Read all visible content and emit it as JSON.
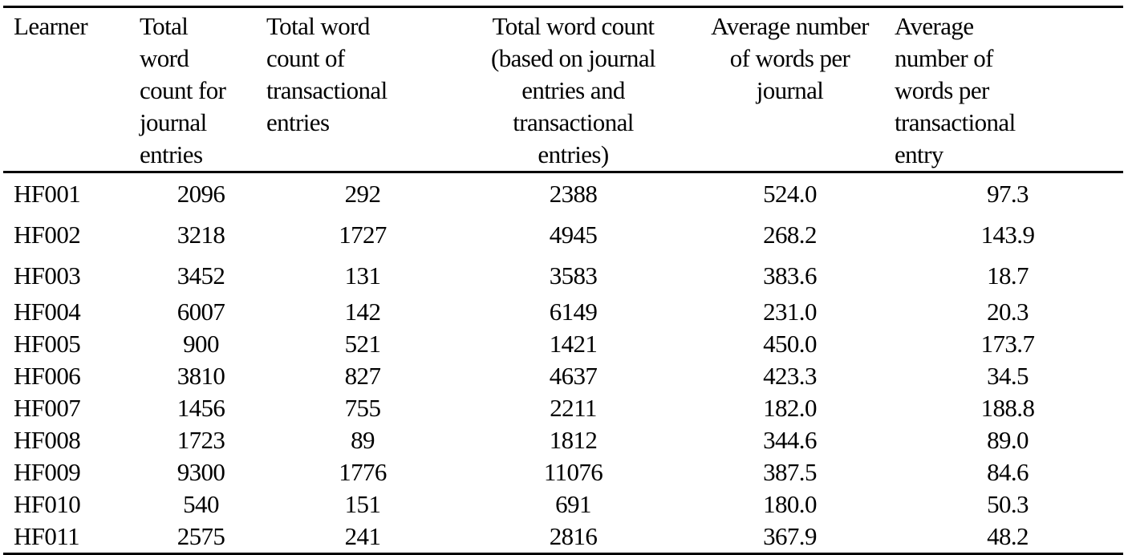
{
  "table": {
    "headers": [
      {
        "lines": [
          "Learner"
        ]
      },
      {
        "lines": [
          "Total",
          "word",
          "count for",
          "journal",
          "entries"
        ]
      },
      {
        "lines": [
          "Total word",
          "count of",
          "transactional",
          "entries"
        ]
      },
      {
        "lines": [
          "Total word count",
          "(based on journal",
          "entries and",
          "transactional",
          "entries)"
        ]
      },
      {
        "lines": [
          "Average number",
          "of words per",
          "journal"
        ]
      },
      {
        "lines": [
          "Average",
          "number of",
          "words per",
          "transactional",
          "entry"
        ]
      }
    ],
    "rows": [
      {
        "learner": "HF001",
        "journal_words": "2096",
        "transactional_words": "292",
        "total_words": "2388",
        "avg_per_journal": "524.0",
        "avg_per_transactional": "97.3"
      },
      {
        "learner": "HF002",
        "journal_words": "3218",
        "transactional_words": "1727",
        "total_words": "4945",
        "avg_per_journal": "268.2",
        "avg_per_transactional": "143.9"
      },
      {
        "learner": "HF003",
        "journal_words": "3452",
        "transactional_words": "131",
        "total_words": "3583",
        "avg_per_journal": "383.6",
        "avg_per_transactional": "18.7"
      },
      {
        "learner": "HF004",
        "journal_words": "6007",
        "transactional_words": "142",
        "total_words": "6149",
        "avg_per_journal": "231.0",
        "avg_per_transactional": "20.3"
      },
      {
        "learner": "HF005",
        "journal_words": "900",
        "transactional_words": "521",
        "total_words": "1421",
        "avg_per_journal": "450.0",
        "avg_per_transactional": "173.7"
      },
      {
        "learner": "HF006",
        "journal_words": "3810",
        "transactional_words": "827",
        "total_words": "4637",
        "avg_per_journal": "423.3",
        "avg_per_transactional": "34.5"
      },
      {
        "learner": "HF007",
        "journal_words": "1456",
        "transactional_words": "755",
        "total_words": "2211",
        "avg_per_journal": "182.0",
        "avg_per_transactional": "188.8"
      },
      {
        "learner": "HF008",
        "journal_words": "1723",
        "transactional_words": "89",
        "total_words": "1812",
        "avg_per_journal": "344.6",
        "avg_per_transactional": "89.0"
      },
      {
        "learner": "HF009",
        "journal_words": "9300",
        "transactional_words": "1776",
        "total_words": "11076",
        "avg_per_journal": "387.5",
        "avg_per_transactional": "84.6"
      },
      {
        "learner": "HF010",
        "journal_words": "540",
        "transactional_words": "151",
        "total_words": "691",
        "avg_per_journal": "180.0",
        "avg_per_transactional": "50.3"
      },
      {
        "learner": "HF011",
        "journal_words": "2575",
        "transactional_words": "241",
        "total_words": "2816",
        "avg_per_journal": "367.9",
        "avg_per_transactional": "48.2"
      }
    ]
  }
}
